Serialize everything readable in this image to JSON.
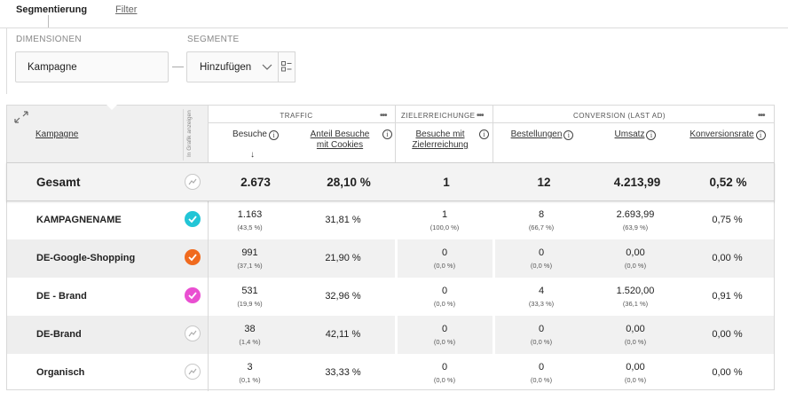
{
  "tabs": {
    "segmentierung": "Segmentierung",
    "filter": "Filter"
  },
  "controls": {
    "dimensionen_label": "DIMENSIONEN",
    "segmente_label": "SEGMENTE",
    "dimension_value": "Kampagne",
    "segment_value": "Hinzufügen"
  },
  "table": {
    "col_kampagne": "Kampagne",
    "in_grafik": "In Grafik anzeigen",
    "groups": {
      "traffic": "TRAFFIC",
      "zielerreichunge": "ZIELERREICHUNGE",
      "conversion": "CONVERSION (LAST AD)",
      "more": "•••"
    },
    "headers": {
      "besuche": "Besuche",
      "anteil_line1": "Anteil Besuche",
      "anteil_line2": "mit Cookies",
      "ziel_line1": "Besuche mit",
      "ziel_line2": "Zielerreichung",
      "bestellungen": "Bestellungen",
      "umsatz": "Umsatz",
      "konversionsrate": "Konversionsrate",
      "info": "i",
      "sort": "↓"
    },
    "total": {
      "label": "Gesamt",
      "besuche": "2.673",
      "anteil": "28,10 %",
      "ziel": "1",
      "bestellungen": "12",
      "umsatz": "4.213,99",
      "rate": "0,52 %"
    },
    "rows": [
      {
        "name": "KAMPAGNENAME",
        "marker_color": "#22c5d6",
        "besuche": "1.163",
        "besuche_pct": "(43,5 %)",
        "anteil": "31,81 %",
        "ziel": "1",
        "ziel_pct": "(100,0 %)",
        "bestellungen": "8",
        "bestellungen_pct": "(66,7 %)",
        "umsatz": "2.693,99",
        "umsatz_pct": "(63,9 %)",
        "rate": "0,75 %"
      },
      {
        "name": "DE-Google-Shopping",
        "marker_color": "#f06a1e",
        "besuche": "991",
        "besuche_pct": "(37,1 %)",
        "anteil": "21,90 %",
        "ziel": "0",
        "ziel_pct": "(0,0 %)",
        "bestellungen": "0",
        "bestellungen_pct": "(0,0 %)",
        "umsatz": "0,00",
        "umsatz_pct": "(0,0 %)",
        "rate": "0,00 %"
      },
      {
        "name": "DE - Brand",
        "marker_color": "#e94fd1",
        "besuche": "531",
        "besuche_pct": "(19,9 %)",
        "anteil": "32,96 %",
        "ziel": "0",
        "ziel_pct": "(0,0 %)",
        "bestellungen": "4",
        "bestellungen_pct": "(33,3 %)",
        "umsatz": "1.520,00",
        "umsatz_pct": "(36,1 %)",
        "rate": "0,91 %"
      },
      {
        "name": "DE-Brand",
        "marker_color": "",
        "besuche": "38",
        "besuche_pct": "(1,4 %)",
        "anteil": "42,11 %",
        "ziel": "0",
        "ziel_pct": "(0,0 %)",
        "bestellungen": "0",
        "bestellungen_pct": "(0,0 %)",
        "umsatz": "0,00",
        "umsatz_pct": "(0,0 %)",
        "rate": "0,00 %"
      },
      {
        "name": "Organisch",
        "marker_color": "",
        "besuche": "3",
        "besuche_pct": "(0,1 %)",
        "anteil": "33,33 %",
        "ziel": "0",
        "ziel_pct": "(0,0 %)",
        "bestellungen": "0",
        "bestellungen_pct": "(0,0 %)",
        "umsatz": "0,00",
        "umsatz_pct": "(0,0 %)",
        "rate": "0,00 %"
      }
    ]
  },
  "icons": {
    "expand": "expand-icon",
    "trend": "trend-line-icon",
    "check": "check-icon",
    "chevron": "chevron-down-icon",
    "segment_settings": "segment-list-icon"
  }
}
